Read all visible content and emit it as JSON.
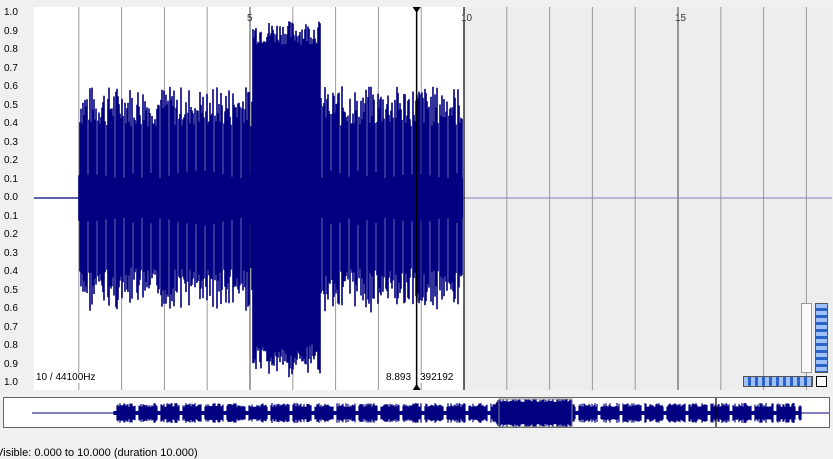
{
  "yaxis": {
    "ticks": [
      "1.0",
      "0.9",
      "0.8",
      "0.7",
      "0.6",
      "0.5",
      "0.4",
      "0.3",
      "0.2",
      "0.1",
      "0.0",
      "0.1",
      "0.2",
      "0.3",
      "0.4",
      "0.5",
      "0.6",
      "0.7",
      "0.8",
      "0.9",
      "1.0"
    ]
  },
  "xaxis": {
    "ticks": [
      "5",
      "10",
      "15"
    ]
  },
  "waveform": {
    "start_s": 0.0,
    "end_s": 10.0,
    "visible_to_s": 18.6,
    "color": "#000080",
    "loud_section_s": [
      5.05,
      6.65
    ]
  },
  "cursor": {
    "time": "8.893",
    "sample": "392192"
  },
  "info": {
    "rate": "10 / 44100Hz"
  },
  "status": {
    "text": "Visible: 0.000 to 10.000 (duration 10.000)"
  }
}
